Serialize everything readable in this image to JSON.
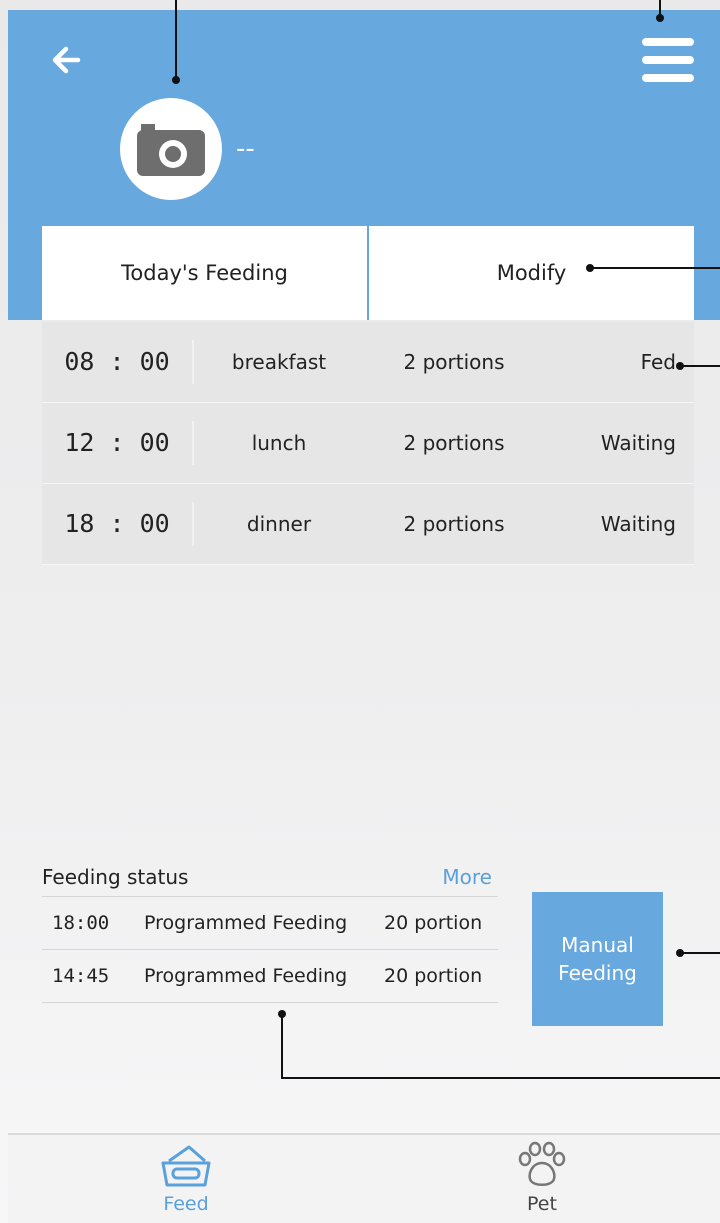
{
  "header": {
    "pet_name": "--",
    "tabs": [
      {
        "label": "Today's Feeding"
      },
      {
        "label": "Modify"
      }
    ]
  },
  "schedule": [
    {
      "time": "08 : 00",
      "meal": "breakfast",
      "portions": "2 portions",
      "status": "Fed"
    },
    {
      "time": "12 : 00",
      "meal": "lunch",
      "portions": "2 portions",
      "status": "Waiting"
    },
    {
      "time": "18 : 00",
      "meal": "dinner",
      "portions": "2 portions",
      "status": "Waiting"
    }
  ],
  "feeding_status": {
    "title": "Feeding status",
    "more_label": "More",
    "entries": [
      {
        "time": "18:00",
        "type": "Programmed Feeding",
        "amount": "20 portion"
      },
      {
        "time": "14:45",
        "type": "Programmed Feeding",
        "amount": "20 portion"
      }
    ]
  },
  "manual_feeding": {
    "line1": "Manual",
    "line2": "Feeding"
  },
  "nav": [
    {
      "label": "Feed",
      "icon": "feed-icon",
      "active": true
    },
    {
      "label": "Pet",
      "icon": "paw-icon",
      "active": false
    }
  ],
  "colors": {
    "header_blue": "#67a8df",
    "accent_text": "#5aa0db"
  }
}
